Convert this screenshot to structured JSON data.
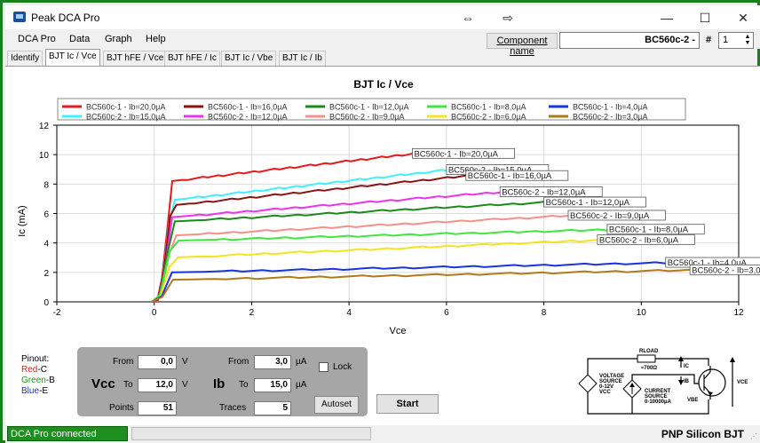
{
  "window": {
    "title": "Peak DCA Pro"
  },
  "menu": [
    "DCA Pro",
    "Data",
    "Graph",
    "Help"
  ],
  "component": {
    "label": "Component name",
    "value": "BC560c-2 -",
    "hash": "#",
    "index": "1"
  },
  "tabs": [
    {
      "label": "Identify",
      "active": false
    },
    {
      "label": "BJT Ic / Vce",
      "active": true
    },
    {
      "label": "BJT hFE / Vce",
      "active": false
    },
    {
      "label": "BJT hFE / Ic",
      "active": false
    },
    {
      "label": "BJT Ic / Vbe",
      "active": false
    },
    {
      "label": "BJT Ic / Ib",
      "active": false
    }
  ],
  "chart_data": {
    "type": "line",
    "title": "BJT Ic / Vce",
    "xlabel": "Vce",
    "ylabel": "Ic (mA)",
    "xlim": [
      -2,
      12
    ],
    "ylim": [
      0,
      12
    ],
    "xticks": [
      -2,
      0,
      2,
      4,
      6,
      8,
      10,
      12
    ],
    "yticks": [
      0,
      2,
      4,
      6,
      8,
      10,
      12
    ],
    "grid": true,
    "legend_position": "top",
    "series": [
      {
        "name": "BC560c-1 - Ib=20,0µA",
        "color": "#e8191b",
        "label": "BC560c-1 - Ib=20,0µA",
        "vmax": 5.3,
        "isat": 8.2,
        "iend": 10.05
      },
      {
        "name": "BC560c-2 - Ib=15,0µA",
        "color": "#3ff0ff",
        "label": "BC560c-2 - Ib=15,0µA",
        "vmax": 6.0,
        "isat": 6.9,
        "iend": 8.95
      },
      {
        "name": "BC560c-1 - Ib=16,0µA",
        "color": "#8b1212",
        "label": "BC560c-1 - Ib=16,0µA",
        "vmax": 6.4,
        "isat": 6.55,
        "iend": 8.55
      },
      {
        "name": "BC560c-2 - Ib=12,0µA",
        "color": "#ee33ee",
        "label": "BC560c-2 - Ib=12,0µA",
        "vmax": 7.1,
        "isat": 5.75,
        "iend": 7.45
      },
      {
        "name": "BC560c-1 - Ib=12,0µA",
        "color": "#1a8a1a",
        "label": "BC560c-1 - Ib=12,0µA",
        "vmax": 8.0,
        "isat": 5.45,
        "iend": 6.75
      },
      {
        "name": "BC560c-2 - Ib=9,0µA",
        "color": "#f5918a",
        "label": "BC560c-2 - Ib=9,0µA",
        "vmax": 8.5,
        "isat": 4.5,
        "iend": 5.85
      },
      {
        "name": "BC560c-1 - Ib=8,0µA",
        "color": "#3ee83e",
        "label": "BC560c-1 - Ib=8,0µA",
        "vmax": 9.3,
        "isat": 4.15,
        "iend": 4.9
      },
      {
        "name": "BC560c-2 - Ib=6,0µA",
        "color": "#f4e41c",
        "label": "BC560c-2 - Ib=6,0µA",
        "vmax": 9.1,
        "isat": 3.0,
        "iend": 4.2
      },
      {
        "name": "BC560c-1 - Ib=4,0µA",
        "color": "#1734e0",
        "label": "BC560c-1 - Ib=4,0µA",
        "vmax": 10.5,
        "isat": 2.0,
        "iend": 2.65
      },
      {
        "name": "BC560c-2 - Ib=3,0µA",
        "color": "#b07b1a",
        "label": "BC560c-2 - Ib=3,0µA",
        "vmax": 11.0,
        "isat": 1.5,
        "iend": 2.15
      }
    ]
  },
  "legend_order": [
    0,
    2,
    4,
    6,
    8,
    1,
    3,
    5,
    7,
    9
  ],
  "pinout": {
    "title": "Pinout:",
    "red": "Red",
    "red_pin": "-C",
    "green": "Green",
    "green_pin": "-B",
    "blue": "Blue",
    "blue_pin": "-E"
  },
  "controls": {
    "vcc_label": "Vcc",
    "ib_label": "Ib",
    "from_label": "From",
    "to_label": "To",
    "points_label": "Points",
    "traces_label": "Traces",
    "vcc_from": "0,0",
    "vcc_to": "12,0",
    "vcc_unit": "V",
    "ib_from": "3,0",
    "ib_to": "15,0",
    "ib_unit": "µA",
    "points": "51",
    "traces": "5",
    "lock_label": "Lock",
    "autoset_label": "Autoset",
    "start_label": "Start"
  },
  "circuit": {
    "rload": "RLOAD",
    "rload_value": "≈700Ω",
    "ic": "IC",
    "ib": "IB",
    "vce": "VCE",
    "vbe": "VBE",
    "vsource": "VOLTAGE",
    "vsource2": "SOURCE",
    "vsource_range": "0-12V",
    "vcc": "VCC",
    "isource": "CURRENT",
    "isource2": "SOURCE",
    "isource_range": "0-10000µA"
  },
  "status": {
    "connection": "DCA Pro connected",
    "device": "PNP Silicon BJT"
  }
}
